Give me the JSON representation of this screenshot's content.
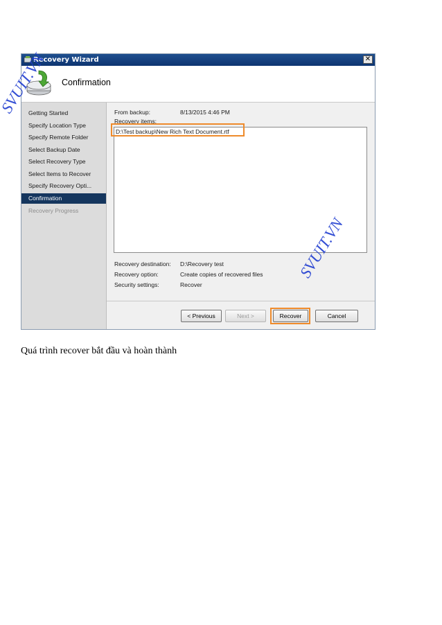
{
  "window": {
    "title": "Recovery Wizard",
    "close_label": "✕"
  },
  "header": {
    "title": "Confirmation"
  },
  "nav": {
    "items": [
      {
        "label": "Getting Started"
      },
      {
        "label": "Specify Location Type"
      },
      {
        "label": "Specify Remote Folder"
      },
      {
        "label": "Select Backup Date"
      },
      {
        "label": "Select Recovery Type"
      },
      {
        "label": "Select Items to Recover"
      },
      {
        "label": "Specify Recovery Opti..."
      },
      {
        "label": "Confirmation"
      },
      {
        "label": "Recovery Progress"
      }
    ]
  },
  "details": {
    "from_backup_label": "From backup:",
    "from_backup_value": "8/13/2015 4:46 PM",
    "recovery_items_label": "Recovery items:",
    "recovery_item": "D:\\Test backup\\New Rich Text Document.rtf",
    "destination_label": "Recovery destination:",
    "destination_value": "D:\\Recovery test",
    "option_label": "Recovery option:",
    "option_value": "Create copies of recovered files",
    "security_label": "Security settings:",
    "security_value": "Recover"
  },
  "buttons": {
    "previous": "< Previous",
    "next": "Next >",
    "recover": "Recover",
    "cancel": "Cancel"
  },
  "watermark": {
    "text": "SVUIT.VN"
  },
  "caption": "Quá trình recover bắt đầu và hoàn thành",
  "colors": {
    "highlight": "#ee8a2a",
    "active_nav": "#15365e",
    "watermark": "#1f3cd0"
  }
}
